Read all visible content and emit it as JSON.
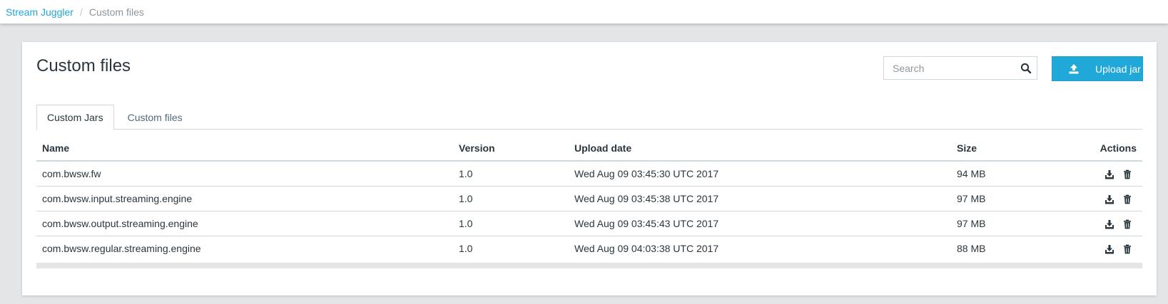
{
  "breadcrumb": {
    "root": "Stream Juggler",
    "separator": "/",
    "current": "Custom files"
  },
  "page": {
    "title": "Custom files"
  },
  "search": {
    "placeholder": "Search",
    "value": "",
    "icon": "search-icon"
  },
  "upload": {
    "label": "Upload jar",
    "icon": "upload-icon"
  },
  "tabs": [
    {
      "label": "Custom Jars",
      "active": true
    },
    {
      "label": "Custom files",
      "active": false
    }
  ],
  "table": {
    "headers": {
      "name": "Name",
      "version": "Version",
      "upload_date": "Upload date",
      "size": "Size",
      "actions": "Actions"
    },
    "rows": [
      {
        "name": "com.bwsw.fw",
        "version": "1.0",
        "upload_date": "Wed Aug 09 03:45:30 UTC 2017",
        "size": "94 MB"
      },
      {
        "name": "com.bwsw.input.streaming.engine",
        "version": "1.0",
        "upload_date": "Wed Aug 09 03:45:38 UTC 2017",
        "size": "97 MB"
      },
      {
        "name": "com.bwsw.output.streaming.engine",
        "version": "1.0",
        "upload_date": "Wed Aug 09 03:45:43 UTC 2017",
        "size": "97 MB"
      },
      {
        "name": "com.bwsw.regular.streaming.engine",
        "version": "1.0",
        "upload_date": "Wed Aug 09 04:03:38 UTC 2017",
        "size": "88 MB"
      }
    ],
    "row_actions": [
      "download-icon",
      "trash-icon"
    ]
  },
  "colors": {
    "accent": "#20a8d8",
    "text": "#29363d",
    "muted": "#8c969c",
    "border": "#cfd8dc",
    "background": "#e4e5e6"
  }
}
